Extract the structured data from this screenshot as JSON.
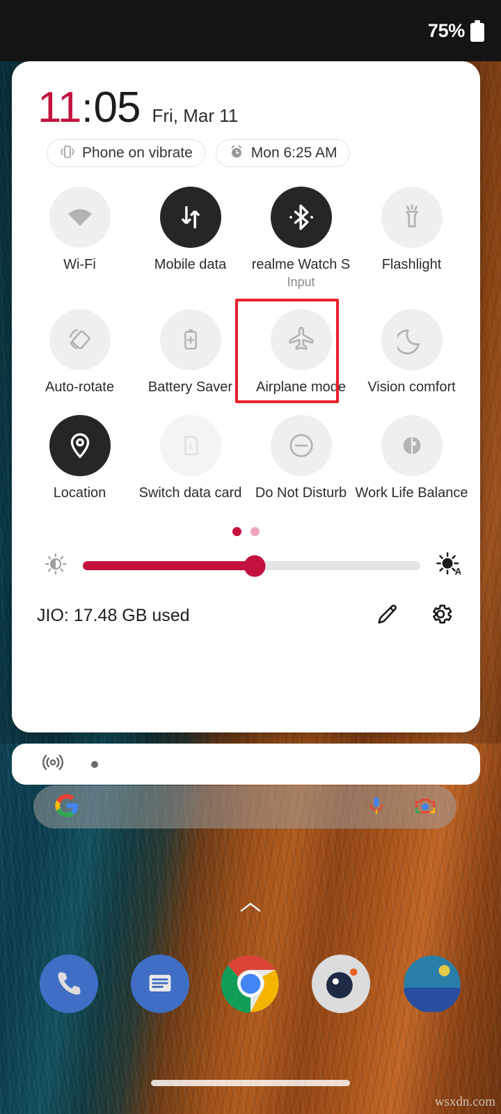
{
  "status_bar": {
    "battery_percent": "75%",
    "battery_icon": "battery-full-icon"
  },
  "quick_settings": {
    "clock": {
      "hours": "11",
      "colon": ":",
      "minutes": "05",
      "date": "Fri, Mar 11",
      "hour_color": "#c4123f"
    },
    "chips": [
      {
        "icon": "vibrate-icon",
        "label": "Phone on vibrate"
      },
      {
        "icon": "alarm-icon",
        "label": "Mon 6:25 AM"
      }
    ],
    "tiles": [
      [
        {
          "label": "Wi-Fi",
          "icon": "wifi-icon",
          "state": "off",
          "sub": ""
        },
        {
          "label": "Mobile data",
          "icon": "mobile-data-icon",
          "state": "on",
          "sub": ""
        },
        {
          "label": "realme Watch S",
          "icon": "bluetooth-icon",
          "state": "on",
          "sub": "Input"
        },
        {
          "label": "Flashlight",
          "icon": "flashlight-icon",
          "state": "off",
          "sub": ""
        }
      ],
      [
        {
          "label": "Auto-rotate",
          "icon": "auto-rotate-icon",
          "state": "off",
          "sub": ""
        },
        {
          "label": "Battery Saver",
          "icon": "battery-saver-icon",
          "state": "off",
          "sub": ""
        },
        {
          "label": "Airplane mode",
          "icon": "airplane-icon",
          "state": "off",
          "sub": "",
          "highlighted": true
        },
        {
          "label": "Vision comfort",
          "icon": "moon-icon",
          "state": "off",
          "sub": ""
        }
      ],
      [
        {
          "label": "Location",
          "icon": "location-pin-icon",
          "state": "on",
          "sub": ""
        },
        {
          "label": "Switch data card",
          "icon": "sim-card-icon",
          "state": "disabled",
          "sub": ""
        },
        {
          "label": "Do Not Disturb",
          "icon": "do-not-disturb-icon",
          "state": "off",
          "sub": ""
        },
        {
          "label": "Work Life Balance",
          "icon": "work-life-balance-icon",
          "state": "off",
          "sub": ""
        }
      ]
    ],
    "pager": {
      "total": 2,
      "active_index": 0,
      "active_color": "#c4123f",
      "inactive_color": "#eda5bb"
    },
    "brightness": {
      "left_icon": "brightness-low-icon",
      "right_icon": "brightness-auto-icon",
      "value_percent": 51,
      "fill_color": "#c4123f"
    },
    "footer": {
      "carrier_usage": "JIO: 17.48 GB used",
      "edit_icon": "pencil-edit-icon",
      "settings_icon": "gear-icon"
    }
  },
  "media_card": {
    "cast_icon": "broadcast-icon",
    "indicator": "dot"
  },
  "search_bar": {
    "logo_icon": "google-g-icon",
    "mic_icon": "microphone-icon",
    "lens_icon": "google-lens-camera-icon"
  },
  "home_screen": {
    "page_chevron_icon": "chevron-up-icon",
    "dock_apps": [
      {
        "name": "Phone",
        "icon": "phone-icon"
      },
      {
        "name": "Messages",
        "icon": "messages-icon"
      },
      {
        "name": "Chrome",
        "icon": "chrome-icon"
      },
      {
        "name": "Camera",
        "icon": "camera-icon"
      },
      {
        "name": "Gallery",
        "icon": "gallery-icon"
      }
    ],
    "nav_bar": "home-gesture-pill"
  },
  "watermark": {
    "text": "wsxdn.com"
  }
}
